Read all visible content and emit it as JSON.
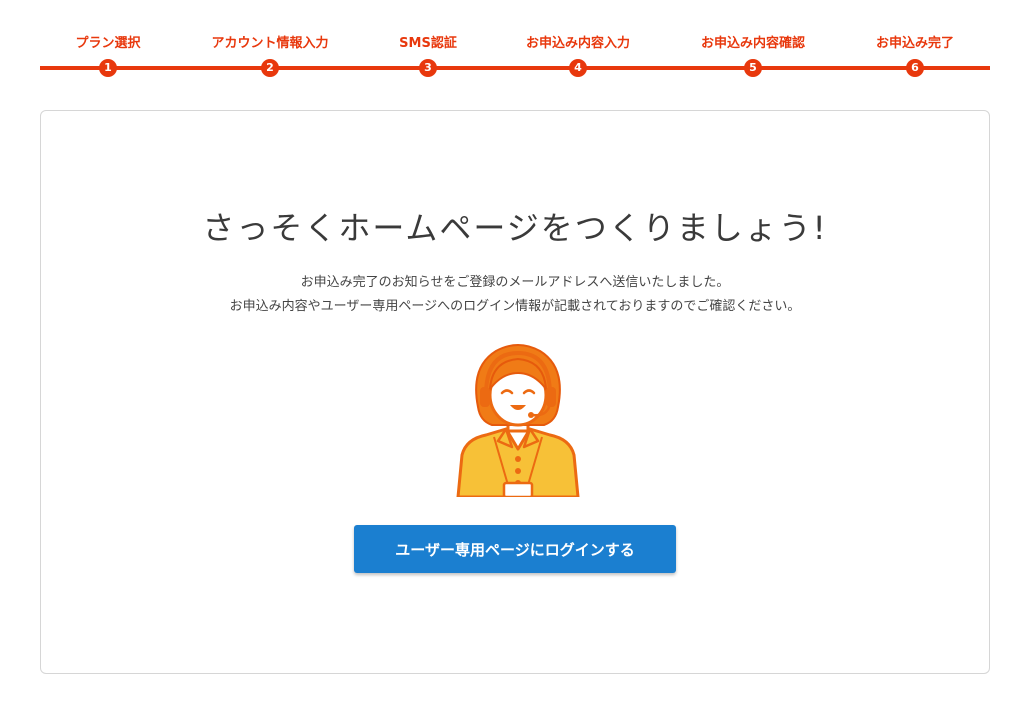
{
  "progress": {
    "current_step": 6,
    "steps": [
      {
        "number": "1",
        "label": "プラン選択"
      },
      {
        "number": "2",
        "label": "アカウント情報入力"
      },
      {
        "number": "3",
        "label": "SMS認証"
      },
      {
        "number": "4",
        "label": "お申込み内容入力"
      },
      {
        "number": "5",
        "label": "お申込み内容確認"
      },
      {
        "number": "6",
        "label": "お申込み完了"
      }
    ],
    "accent_color": "#e8380d"
  },
  "main": {
    "headline": "さっそくホームページをつくりましょう!",
    "message_line1": "お申込み完了のお知らせをご登録のメールアドレスへ送信いたしました。",
    "message_line2": "お申込み内容やユーザー専用ページへのログイン情報が記載されておりますのでご確認ください。",
    "illustration": "support-operator-illustration",
    "login_button_label": "ユーザー専用ページにログインする",
    "button_color": "#1b7fd0"
  }
}
